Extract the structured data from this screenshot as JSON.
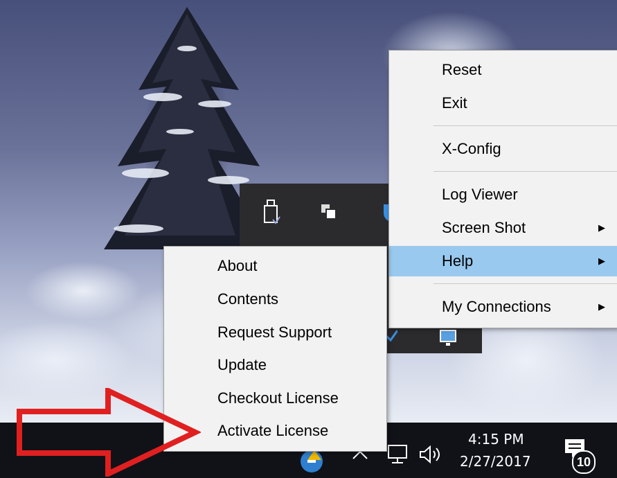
{
  "main_menu": {
    "items": [
      {
        "label": "Reset"
      },
      {
        "label": "Exit"
      },
      {
        "label": "X-Config"
      },
      {
        "label": "Log Viewer"
      },
      {
        "label": "Screen Shot"
      },
      {
        "label": "Help"
      },
      {
        "label": "My Connections"
      }
    ]
  },
  "help_submenu": {
    "items": [
      {
        "label": "About"
      },
      {
        "label": "Contents"
      },
      {
        "label": "Request Support"
      },
      {
        "label": "Update"
      },
      {
        "label": "Checkout License"
      },
      {
        "label": "Activate License"
      }
    ]
  },
  "taskbar": {
    "time": "4:15 PM",
    "date": "2/27/2017",
    "notification_count": "10"
  },
  "colors": {
    "menu_bg": "#f2f2f2",
    "highlight": "#99c9ef",
    "taskbar": "#101218",
    "annotation_arrow": "#e02020"
  }
}
